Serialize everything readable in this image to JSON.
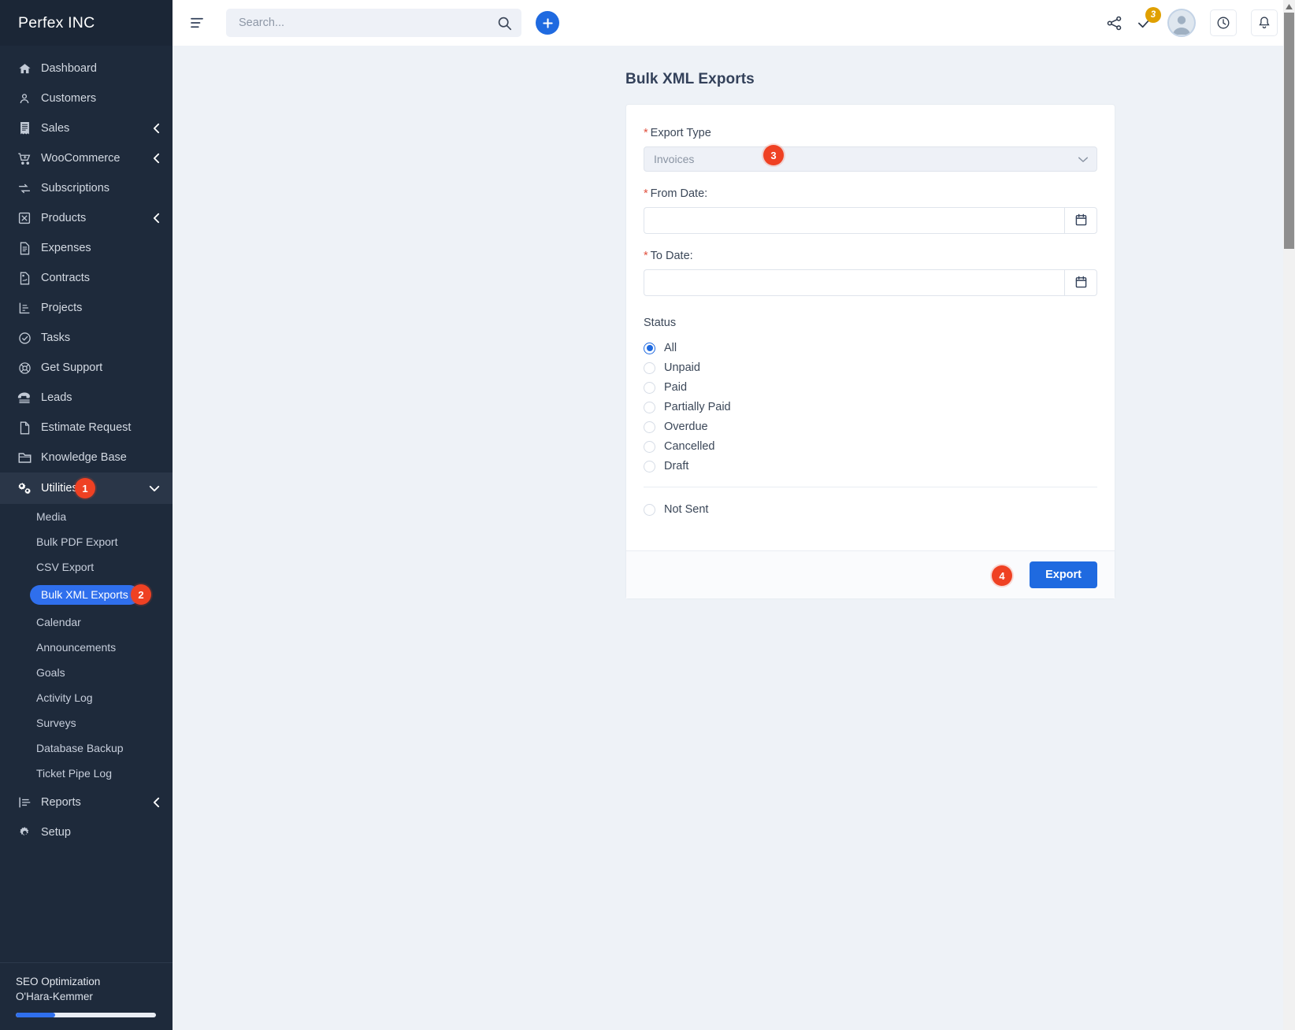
{
  "brand": {
    "name": "Perfex INC"
  },
  "topbar": {
    "hamburger_icon": "menu-icon",
    "search": {
      "placeholder": "Search...",
      "value": "",
      "icon": "search-icon"
    },
    "add_button_icon": "plus-icon",
    "share_icon": "share-icon",
    "tasks_icon": "checkmark-icon",
    "tasks_badge": "3",
    "avatar_icon": "user-avatar",
    "clock_icon": "clock-icon",
    "bell_icon": "bell-icon"
  },
  "sidebar": {
    "items": [
      {
        "label": "Dashboard",
        "icon": "home-icon",
        "expandable": false
      },
      {
        "label": "Customers",
        "icon": "user-icon",
        "expandable": false
      },
      {
        "label": "Sales",
        "icon": "receipt-icon",
        "expandable": true
      },
      {
        "label": "WooCommerce",
        "icon": "cart-icon",
        "expandable": true
      },
      {
        "label": "Subscriptions",
        "icon": "refresh-icon",
        "expandable": false
      },
      {
        "label": "Products",
        "icon": "box-icon",
        "expandable": true
      },
      {
        "label": "Expenses",
        "icon": "document-icon",
        "expandable": false
      },
      {
        "label": "Contracts",
        "icon": "contract-icon",
        "expandable": false
      },
      {
        "label": "Projects",
        "icon": "chart-icon",
        "expandable": false
      },
      {
        "label": "Tasks",
        "icon": "check-circle-icon",
        "expandable": false
      },
      {
        "label": "Get Support",
        "icon": "lifebuoy-icon",
        "expandable": false
      },
      {
        "label": "Leads",
        "icon": "phone-icon",
        "expandable": false
      },
      {
        "label": "Estimate Request",
        "icon": "file-icon",
        "expandable": false
      },
      {
        "label": "Knowledge Base",
        "icon": "folder-icon",
        "expandable": false
      }
    ],
    "utilities": {
      "label": "Utilities",
      "icon": "gears-icon",
      "badge": "1",
      "expanded": true,
      "sub_items": [
        {
          "label": "Media",
          "selected": false
        },
        {
          "label": "Bulk PDF Export",
          "selected": false
        },
        {
          "label": "CSV Export",
          "selected": false
        },
        {
          "label": "Bulk XML Exports",
          "selected": true,
          "badge": "2"
        },
        {
          "label": "Calendar",
          "selected": false
        },
        {
          "label": "Announcements",
          "selected": false
        },
        {
          "label": "Goals",
          "selected": false
        },
        {
          "label": "Activity Log",
          "selected": false
        },
        {
          "label": "Surveys",
          "selected": false
        },
        {
          "label": "Database Backup",
          "selected": false
        },
        {
          "label": "Ticket Pipe Log",
          "selected": false
        }
      ]
    },
    "tail_items": [
      {
        "label": "Reports",
        "icon": "bars-icon",
        "expandable": true
      },
      {
        "label": "Setup",
        "icon": "gear-icon",
        "expandable": false
      }
    ],
    "footer": {
      "title": "SEO Optimization",
      "subtitle": "O'Hara-Kemmer",
      "progress_percent": 28
    }
  },
  "main": {
    "page_title": "Bulk XML Exports",
    "form": {
      "export_type": {
        "label": "Export Type",
        "required": true,
        "value": "Invoices",
        "badge": "3",
        "chevron_icon": "chevron-down-icon"
      },
      "from_date": {
        "label": "From Date:",
        "required": true,
        "value": "",
        "calendar_icon": "calendar-icon"
      },
      "to_date": {
        "label": "To Date:",
        "required": true,
        "value": "",
        "calendar_icon": "calendar-icon"
      },
      "status": {
        "label": "Status",
        "options": [
          {
            "label": "All",
            "checked": true
          },
          {
            "label": "Unpaid",
            "checked": false
          },
          {
            "label": "Paid",
            "checked": false
          },
          {
            "label": "Partially Paid",
            "checked": false
          },
          {
            "label": "Overdue",
            "checked": false
          },
          {
            "label": "Cancelled",
            "checked": false
          },
          {
            "label": "Draft",
            "checked": false
          }
        ],
        "extra_options": [
          {
            "label": "Not Sent",
            "checked": false
          }
        ]
      },
      "export_button": {
        "label": "Export",
        "badge": "4"
      }
    }
  },
  "colors": {
    "sidebar_bg": "#1e2a3b",
    "accent_blue": "#1f6ae0",
    "badge_red": "#ef4123",
    "badge_amber": "#e0a000",
    "required_red": "#e0503e",
    "content_bg": "#eef2f7"
  }
}
